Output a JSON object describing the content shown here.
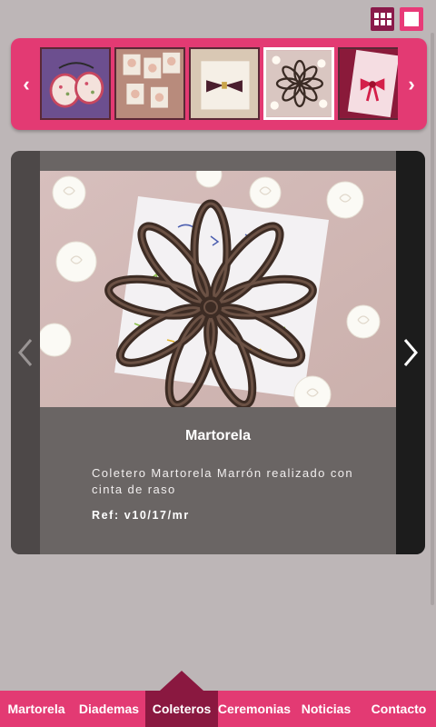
{
  "view_toggle": {
    "grid_icon": "grid-view-icon",
    "single_icon": "single-view-icon"
  },
  "thumb_strip": {
    "prev_icon": "chevron-left-icon",
    "next_icon": "chevron-right-icon",
    "prev_glyph": "‹",
    "next_glyph": "›",
    "thumbnails": [
      {
        "subject": "pink-floral-hair-ties"
      },
      {
        "subject": "floral-clips-on-cards"
      },
      {
        "subject": "burgundy-bow"
      },
      {
        "subject": "brown-ribbon-flower",
        "active": true
      },
      {
        "subject": "pink-bow-on-card"
      }
    ]
  },
  "product": {
    "title": "Martorela",
    "description": "Coletero Martorela Marrón realizado con cinta de raso",
    "ref": "Ref: v10/17/mr"
  },
  "nav": {
    "items": [
      "Martorela",
      "Diademas",
      "Coleteros",
      "Ceremonias",
      "Noticias",
      "Contacto"
    ],
    "active": "Coleteros"
  },
  "colors": {
    "accent": "#e33a73",
    "accent_dark": "#8a1840",
    "background": "#bdb6b7",
    "card": "#6a6564"
  }
}
